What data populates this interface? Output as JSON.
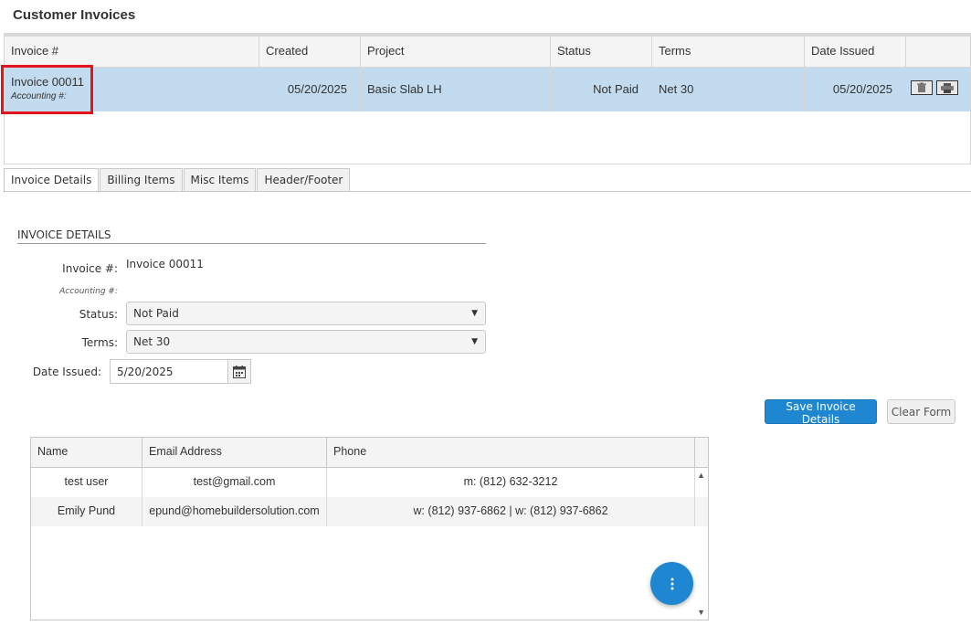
{
  "page_title": "Customer Invoices",
  "invoice_grid": {
    "columns": [
      "Invoice #",
      "Created",
      "Project",
      "Status",
      "Terms",
      "Date Issued",
      ""
    ],
    "rows": [
      {
        "invoice": "Invoice 00011",
        "accounting": "Accounting #:",
        "created": "05/20/2025",
        "project": "Basic Slab LH",
        "status": "Not Paid",
        "terms": "Net 30",
        "date_issued": "05/20/2025"
      }
    ]
  },
  "tabs": [
    "Invoice Details",
    "Billing Items",
    "Misc Items",
    "Header/Footer"
  ],
  "form": {
    "section_title": "INVOICE DETAILS",
    "invoice_label": "Invoice #:",
    "invoice_value": "Invoice 00011",
    "accounting_label": "Accounting #:",
    "status_label": "Status:",
    "status_value": "Not Paid",
    "terms_label": "Terms:",
    "terms_value": "Net 30",
    "date_label": "Date Issued:",
    "date_value": "5/20/2025",
    "save_label": "Save Invoice Details",
    "clear_label": "Clear Form"
  },
  "contacts": {
    "columns": [
      "Name",
      "Email Address",
      "Phone"
    ],
    "rows": [
      {
        "name": "test user",
        "email": "test@gmail.com",
        "phone": "m: (812) 632-3212"
      },
      {
        "name": "Emily Pund",
        "email": "epund@homebuildersolution.com",
        "phone": "w: (812) 937-6862 | w: (812) 937-6862"
      }
    ]
  },
  "colors": {
    "accent": "#1f87d1",
    "selected_row": "#c2dbee",
    "highlight": "#e3141e"
  },
  "icons": [
    "trash-icon",
    "print-icon",
    "calendar-icon",
    "chevron-down-icon",
    "more-vertical-icon"
  ]
}
